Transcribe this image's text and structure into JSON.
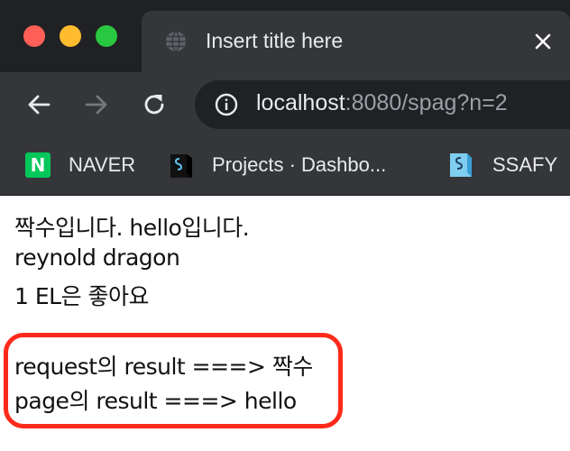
{
  "tab": {
    "title": "Insert title here"
  },
  "address_bar": {
    "host": "localhost",
    "rest": ":8080/spag?n=2"
  },
  "bookmarks": [
    {
      "label": "NAVER",
      "icon": "naver-icon",
      "icon_text": "N"
    },
    {
      "label": "Projects · Dashbo...",
      "icon": "projects-icon"
    },
    {
      "label": "SSAFY",
      "icon": "ssafy-icon"
    }
  ],
  "page": {
    "lines": [
      "짝수입니다. hello입니다.",
      "reynold dragon",
      "1 EL은 좋아요"
    ],
    "highlighted_lines": [
      "request의 result ===> 짝수",
      "page의 result ===> hello"
    ]
  },
  "colors": {
    "tab_strip": "#202124",
    "toolbar": "#35363a",
    "highlight_border": "#ff2a1a",
    "naver_green": "#03c75a"
  }
}
